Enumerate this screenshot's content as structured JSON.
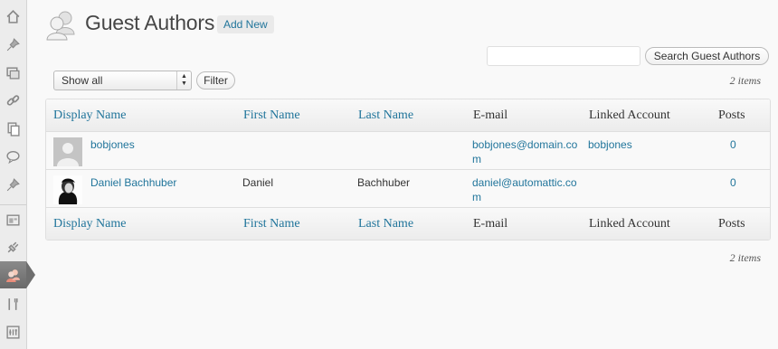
{
  "header": {
    "title": "Guest Authors",
    "add_new": "Add New"
  },
  "search": {
    "input_value": "",
    "button_label": "Search Guest Authors"
  },
  "filter": {
    "selected": "Show all",
    "button_label": "Filter"
  },
  "item_count": "2 items",
  "table": {
    "columns": [
      "Display Name",
      "First Name",
      "Last Name",
      "E-mail",
      "Linked Account",
      "Posts"
    ],
    "rows": [
      {
        "display_name": "bobjones",
        "first_name": "",
        "last_name": "",
        "email": "bobjones@domain.com",
        "linked_account": "bobjones",
        "posts": "0"
      },
      {
        "display_name": "Daniel Bachhuber",
        "first_name": "Daniel",
        "last_name": "Bachhuber",
        "email": "daniel@automattic.com",
        "linked_account": "",
        "posts": "0"
      }
    ]
  },
  "colors": {
    "link": "#21759b",
    "sidebar_bg": "#ececec",
    "current_menu": "#6e6e6e"
  },
  "menu_icons": [
    "dashboard-icon",
    "posts-pin-icon",
    "media-icon",
    "links-icon",
    "pages-icon",
    "comments-icon",
    "pin-icon",
    "appearance-icon",
    "plugins-icon",
    "users-icon",
    "tools-icon",
    "settings-icon"
  ]
}
